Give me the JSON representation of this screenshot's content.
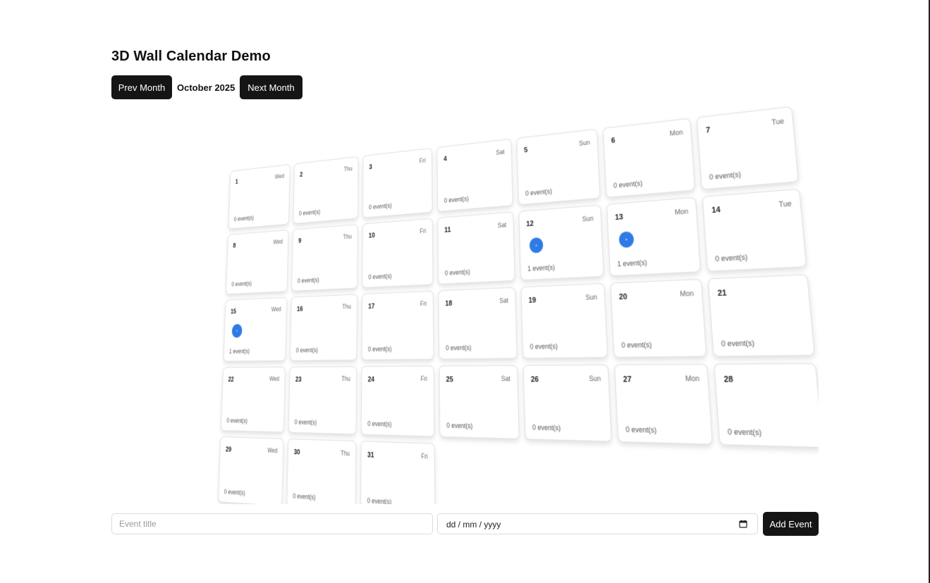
{
  "header": {
    "title": "3D Wall Calendar Demo",
    "prev_label": "Prev Month",
    "month_label": "October 2025",
    "next_label": "Next Month"
  },
  "calendar": {
    "days": [
      {
        "day": "1",
        "dow": "Wed",
        "count": "0 event(s)",
        "events": 0
      },
      {
        "day": "2",
        "dow": "Thu",
        "count": "0 event(s)",
        "events": 0
      },
      {
        "day": "3",
        "dow": "Fri",
        "count": "0 event(s)",
        "events": 0
      },
      {
        "day": "4",
        "dow": "Sat",
        "count": "0 event(s)",
        "events": 0
      },
      {
        "day": "5",
        "dow": "Sun",
        "count": "0 event(s)",
        "events": 0
      },
      {
        "day": "6",
        "dow": "Mon",
        "count": "0 event(s)",
        "events": 0
      },
      {
        "day": "7",
        "dow": "Tue",
        "count": "0 event(s)",
        "events": 0
      },
      {
        "day": "8",
        "dow": "Wed",
        "count": "0 event(s)",
        "events": 0
      },
      {
        "day": "9",
        "dow": "Thu",
        "count": "0 event(s)",
        "events": 0
      },
      {
        "day": "10",
        "dow": "Fri",
        "count": "0 event(s)",
        "events": 0
      },
      {
        "day": "11",
        "dow": "Sat",
        "count": "0 event(s)",
        "events": 0
      },
      {
        "day": "12",
        "dow": "Sun",
        "count": "1 event(s)",
        "events": 1
      },
      {
        "day": "13",
        "dow": "Mon",
        "count": "1 event(s)",
        "events": 1
      },
      {
        "day": "14",
        "dow": "Tue",
        "count": "0 event(s)",
        "events": 0
      },
      {
        "day": "15",
        "dow": "Wed",
        "count": "1 event(s)",
        "events": 1
      },
      {
        "day": "16",
        "dow": "Thu",
        "count": "0 event(s)",
        "events": 0
      },
      {
        "day": "17",
        "dow": "Fri",
        "count": "0 event(s)",
        "events": 0
      },
      {
        "day": "18",
        "dow": "Sat",
        "count": "0 event(s)",
        "events": 0
      },
      {
        "day": "19",
        "dow": "Sun",
        "count": "0 event(s)",
        "events": 0
      },
      {
        "day": "20",
        "dow": "Mon",
        "count": "0 event(s)",
        "events": 0
      },
      {
        "day": "21",
        "dow": "",
        "count": "0 event(s)",
        "events": 0
      },
      {
        "day": "22",
        "dow": "Wed",
        "count": "0 event(s)",
        "events": 0
      },
      {
        "day": "23",
        "dow": "Thu",
        "count": "0 event(s)",
        "events": 0
      },
      {
        "day": "24",
        "dow": "Fri",
        "count": "0 event(s)",
        "events": 0
      },
      {
        "day": "25",
        "dow": "Sat",
        "count": "0 event(s)",
        "events": 0
      },
      {
        "day": "26",
        "dow": "Sun",
        "count": "0 event(s)",
        "events": 0
      },
      {
        "day": "27",
        "dow": "Mon",
        "count": "0 event(s)",
        "events": 0
      },
      {
        "day": "28",
        "dow": "",
        "count": "0 event(s)",
        "events": 0
      },
      {
        "day": "29",
        "dow": "Wed",
        "count": "0 event(s)",
        "events": 0
      },
      {
        "day": "30",
        "dow": "Thu",
        "count": "0 event(s)",
        "events": 0
      },
      {
        "day": "31",
        "dow": "Fri",
        "count": "0 event(s)",
        "events": 0
      }
    ]
  },
  "form": {
    "title_placeholder": "Event title",
    "title_value": "",
    "date_placeholder": "dd / mm / yyyy",
    "add_label": "Add Event"
  },
  "icons": {
    "date_picker": "calendar-icon",
    "event_marker": "event-dot"
  },
  "colors": {
    "button_bg": "#151515",
    "button_text": "#ffffff",
    "event_dot": "#2f7be6"
  }
}
